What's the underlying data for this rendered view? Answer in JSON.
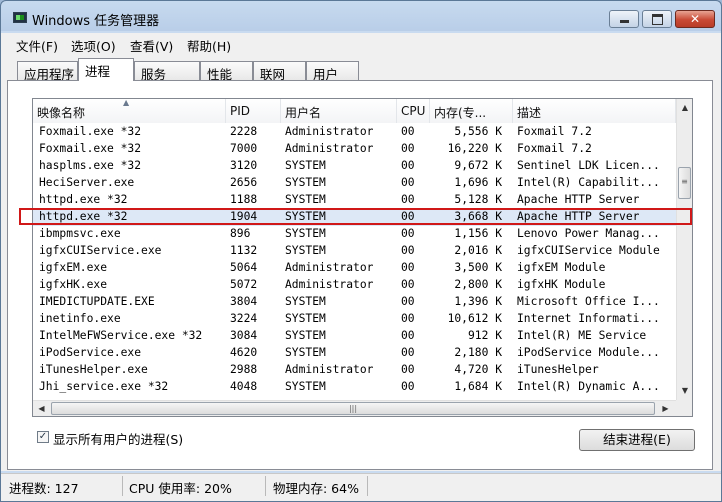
{
  "window": {
    "title": "Windows 任务管理器"
  },
  "menu": [
    "文件(F)",
    "选项(O)",
    "查看(V)",
    "帮助(H)"
  ],
  "tabs": [
    "应用程序",
    "进程",
    "服务",
    "性能",
    "联网",
    "用户"
  ],
  "active_tab": "进程",
  "columns": [
    "映像名称",
    "PID",
    "用户名",
    "CPU",
    "内存(专...",
    "描述"
  ],
  "sorted_column": "映像名称",
  "processes": [
    {
      "name": "Foxmail.exe *32",
      "pid": "2228",
      "user": "Administrator",
      "cpu": "00",
      "mem": "5,556 K",
      "desc": "Foxmail 7.2"
    },
    {
      "name": "Foxmail.exe *32",
      "pid": "7000",
      "user": "Administrator",
      "cpu": "00",
      "mem": "16,220 K",
      "desc": "Foxmail 7.2"
    },
    {
      "name": "hasplms.exe *32",
      "pid": "3120",
      "user": "SYSTEM",
      "cpu": "00",
      "mem": "9,672 K",
      "desc": "Sentinel LDK Licen..."
    },
    {
      "name": "HeciServer.exe",
      "pid": "2656",
      "user": "SYSTEM",
      "cpu": "00",
      "mem": "1,696 K",
      "desc": "Intel(R) Capabilit..."
    },
    {
      "name": "httpd.exe *32",
      "pid": "1188",
      "user": "SYSTEM",
      "cpu": "00",
      "mem": "5,128 K",
      "desc": "Apache HTTP Server"
    },
    {
      "name": "httpd.exe *32",
      "pid": "1904",
      "user": "SYSTEM",
      "cpu": "00",
      "mem": "3,668 K",
      "desc": "Apache HTTP Server"
    },
    {
      "name": "ibmpmsvc.exe",
      "pid": "896",
      "user": "SYSTEM",
      "cpu": "00",
      "mem": "1,156 K",
      "desc": "Lenovo Power Manag..."
    },
    {
      "name": "igfxCUIService.exe",
      "pid": "1132",
      "user": "SYSTEM",
      "cpu": "00",
      "mem": "2,016 K",
      "desc": "igfxCUIService Module"
    },
    {
      "name": "igfxEM.exe",
      "pid": "5064",
      "user": "Administrator",
      "cpu": "00",
      "mem": "3,500 K",
      "desc": "igfxEM Module"
    },
    {
      "name": "igfxHK.exe",
      "pid": "5072",
      "user": "Administrator",
      "cpu": "00",
      "mem": "2,800 K",
      "desc": "igfxHK Module"
    },
    {
      "name": "IMEDICTUPDATE.EXE",
      "pid": "3804",
      "user": "SYSTEM",
      "cpu": "00",
      "mem": "1,396 K",
      "desc": "Microsoft Office I..."
    },
    {
      "name": "inetinfo.exe",
      "pid": "3224",
      "user": "SYSTEM",
      "cpu": "00",
      "mem": "10,612 K",
      "desc": "Internet Informati..."
    },
    {
      "name": "IntelMeFWService.exe *32",
      "pid": "3084",
      "user": "SYSTEM",
      "cpu": "00",
      "mem": "912 K",
      "desc": "Intel(R) ME Service"
    },
    {
      "name": "iPodService.exe",
      "pid": "4620",
      "user": "SYSTEM",
      "cpu": "00",
      "mem": "2,180 K",
      "desc": "iPodService Module..."
    },
    {
      "name": "iTunesHelper.exe",
      "pid": "2988",
      "user": "Administrator",
      "cpu": "00",
      "mem": "4,720 K",
      "desc": "iTunesHelper"
    },
    {
      "name": "Jhi_service.exe *32",
      "pid": "4048",
      "user": "SYSTEM",
      "cpu": "00",
      "mem": "1,684 K",
      "desc": "Intel(R) Dynamic A..."
    }
  ],
  "selected_pid": "1904",
  "show_all_users": {
    "label": "显示所有用户的进程(S)",
    "checked": true
  },
  "end_process_button": "结束进程(E)",
  "status": {
    "process_count": "进程数: 127",
    "cpu_usage": "CPU 使用率: 20%",
    "physical_memory": "物理内存: 64%"
  },
  "icons": {
    "app": "task-manager-icon",
    "minimize": "minimize-icon",
    "maximize": "maximize-icon",
    "close": "close-icon",
    "sort": "sort-ascending-icon",
    "scroll_up": "scroll-up-icon",
    "scroll_down": "scroll-down-icon",
    "scroll_left": "scroll-left-icon",
    "scroll_right": "scroll-right-icon",
    "check": "checkmark-icon"
  },
  "colors": {
    "highlight_border": "#d01818",
    "title_bar": "#b9cee8",
    "close_button": "#c94a35"
  }
}
